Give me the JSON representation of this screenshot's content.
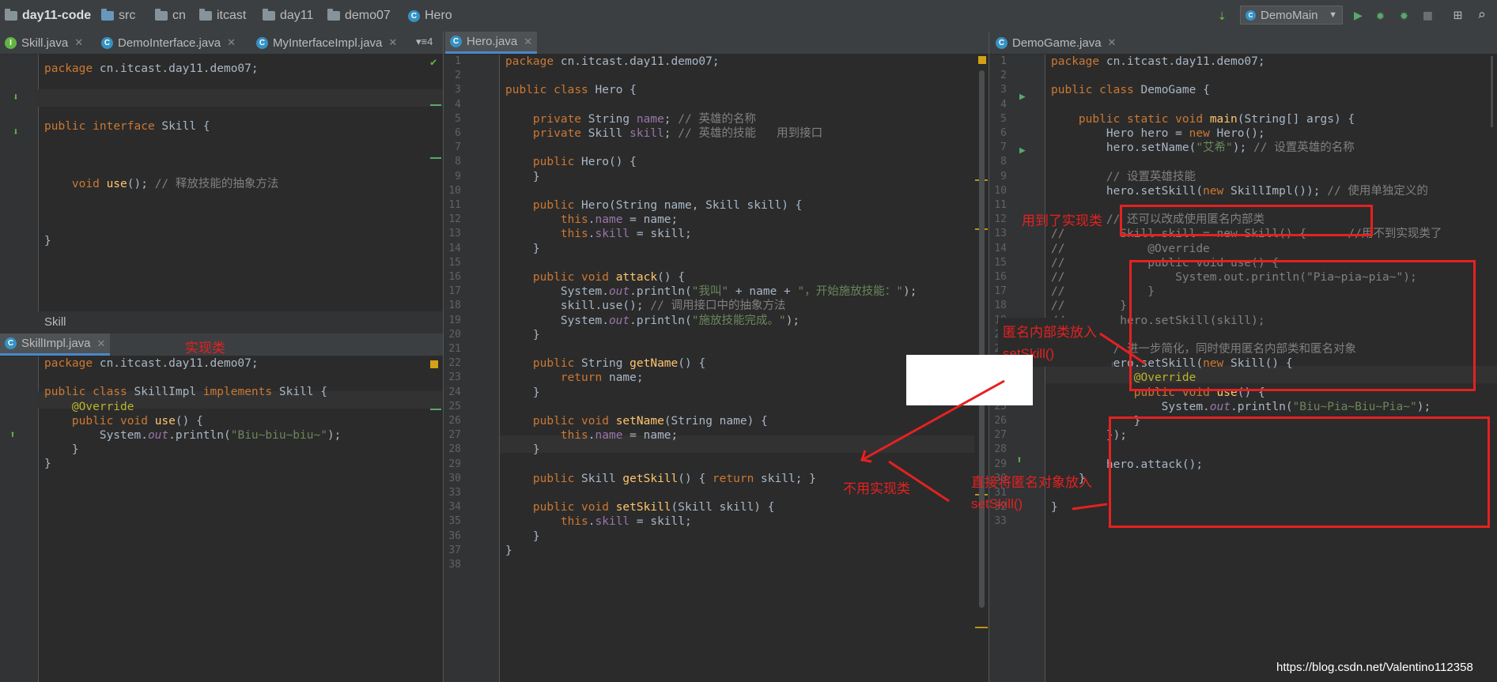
{
  "breadcrumb": {
    "project": "day11-code",
    "items": [
      "src",
      "cn",
      "itcast",
      "day11",
      "demo07",
      "Hero"
    ]
  },
  "toolbar": {
    "run_config": "DemoMain"
  },
  "left_tabs": [
    "Skill.java",
    "DemoInterface.java",
    "MyInterfaceImpl.java"
  ],
  "left_tab_overflow": "▾≡4",
  "center_tab": "Hero.java",
  "right_tab": "DemoGame.java",
  "skill_panel": {
    "lines": [
      "package cn.itcast.day11.demo07;",
      "",
      "public interface Skill {",
      "",
      "    void use(); // 释放技能的抽象方法",
      "",
      "}"
    ],
    "footer": "Skill"
  },
  "impl_panel": {
    "tab": "SkillImpl.java",
    "annotation": "实现类",
    "lines": [
      "package cn.itcast.day11.demo07;",
      "",
      "public class SkillImpl implements Skill {",
      "    @Override",
      "    public void use() {",
      "        System.out.println(\"Biu~biu~biu~\");",
      "    }",
      "}"
    ]
  },
  "hero": {
    "line_numbers": [
      "1",
      "2",
      "3",
      "4",
      "5",
      "6",
      "7",
      "8",
      "9",
      "10",
      "11",
      "12",
      "13",
      "14",
      "15",
      "16",
      "17",
      "18",
      "19",
      "20",
      "21",
      "22",
      "23",
      "24",
      "25",
      "26",
      "27",
      "28",
      "29",
      "30",
      "33",
      "34",
      "35",
      "36",
      "37",
      "38"
    ],
    "lines": [
      "package cn.itcast.day11.demo07;",
      "",
      "public class Hero {",
      "",
      "    private String name; // 英雄的名称",
      "    private Skill skill; // 英雄的技能   用到接口",
      "",
      "    public Hero() {",
      "    }",
      "",
      "    public Hero(String name, Skill skill) {",
      "        this.name = name;",
      "        this.skill = skill;",
      "    }",
      "",
      "    public void attack() {",
      "        System.out.println(\"我叫\" + name + \"，开始施放技能：\");",
      "        skill.use(); // 调用接口中的抽象方法",
      "        System.out.println(\"施放技能完成。\");",
      "    }",
      "",
      "    public String getName() {",
      "        return name;",
      "    }",
      "",
      "    public void setName(String name) {",
      "        this.name = name;",
      "    }",
      "",
      "    public Skill getSkill() { return skill; }",
      "",
      "    public void setSkill(Skill skill) {",
      "        this.skill = skill;",
      "    }",
      "}",
      ""
    ]
  },
  "game": {
    "line_numbers": [
      "1",
      "2",
      "3",
      "4",
      "5",
      "6",
      "7",
      "8",
      "9",
      "10",
      "11",
      "12",
      "13",
      "14",
      "15",
      "16",
      "17",
      "18",
      "19",
      "20",
      "21",
      "22",
      "23",
      "24",
      "25",
      "26",
      "27",
      "28",
      "29",
      "30",
      "31",
      "32",
      "33"
    ],
    "lines": [
      "package cn.itcast.day11.demo07;",
      "",
      "public class DemoGame {",
      "",
      "    public static void main(String[] args) {",
      "        Hero hero = new Hero();",
      "        hero.setName(\"艾希\"); // 设置英雄的名称",
      "",
      "        // 设置英雄技能",
      "        hero.setSkill(new SkillImpl()); // 使用单独定义的",
      "",
      "        // 还可以改成使用匿名内部类",
      "//        Skill skill = new Skill() {      //用不到实现类了",
      "//            @Override",
      "//            public void use() {",
      "//                System.out.println(\"Pia~pia~pia~\");",
      "//            }",
      "//        };",
      "//        hero.setSkill(skill);",
      "",
      "        // 进一步简化，同时使用匿名内部类和匿名对象",
      "        hero.setSkill(new Skill() {",
      "            @Override",
      "            public void use() {",
      "                System.out.println(\"Biu~Pia~Biu~Pia~\");",
      "            }",
      "        });",
      "",
      "        hero.attack();",
      "    }",
      "",
      "}",
      ""
    ]
  },
  "annotations": {
    "uses_impl": "用到了实现类",
    "anon_inner_1": "匿名内部类放入",
    "anon_inner_2": "setSkill()",
    "no_impl": "不用实现类",
    "direct_anon_1": "直接将匿名对象放入",
    "direct_anon_2": "setSkill()"
  },
  "watermark": "https://blog.csdn.net/Valentino112358",
  "colors": {
    "annotation_red": "#e52121",
    "keyword": "#cc7832",
    "string": "#6a8759",
    "comment": "#808080",
    "field": "#9876aa"
  }
}
